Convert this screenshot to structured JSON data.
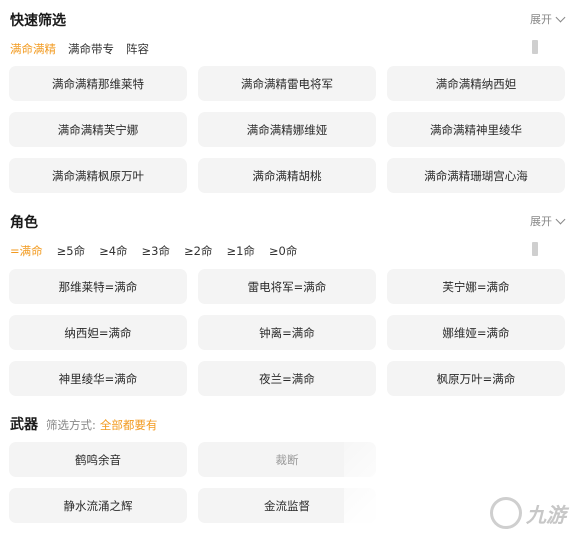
{
  "quick_filter": {
    "title": "快速筛选",
    "expand_label": "展开",
    "tabs": [
      {
        "label": "满命满精",
        "active": true
      },
      {
        "label": "满命带专",
        "active": false
      },
      {
        "label": "阵容",
        "active": false
      }
    ],
    "items": [
      "满命满精那维莱特",
      "满命满精雷电将军",
      "满命满精纳西妲",
      "满命满精芙宁娜",
      "满命满精娜维娅",
      "满命满精神里绫华",
      "满命满精枫原万叶",
      "满命满精胡桃",
      "满命满精珊瑚宫心海"
    ]
  },
  "character": {
    "title": "角色",
    "expand_label": "展开",
    "tabs": [
      {
        "label": "=满命",
        "active": true
      },
      {
        "label": "≥5命",
        "active": false
      },
      {
        "label": "≥4命",
        "active": false
      },
      {
        "label": "≥3命",
        "active": false
      },
      {
        "label": "≥2命",
        "active": false
      },
      {
        "label": "≥1命",
        "active": false
      },
      {
        "label": "≥0命",
        "active": false
      }
    ],
    "items": [
      "那维莱特=满命",
      "雷电将军=满命",
      "芙宁娜=满命",
      "纳西妲=满命",
      "钟离=满命",
      "娜维娅=满命",
      "神里绫华=满命",
      "夜兰=满命",
      "枫原万叶=满命"
    ]
  },
  "weapon": {
    "title": "武器",
    "filter_label": "筛选方式:",
    "filter_value": "全部都要有",
    "items": [
      "鹤鸣余音",
      "裁断",
      "静水流涌之辉",
      "金流监督"
    ]
  },
  "watermark": {
    "text": "九游"
  },
  "colors": {
    "accent": "#f29a1f",
    "chip_bg": "#f4f4f4"
  }
}
